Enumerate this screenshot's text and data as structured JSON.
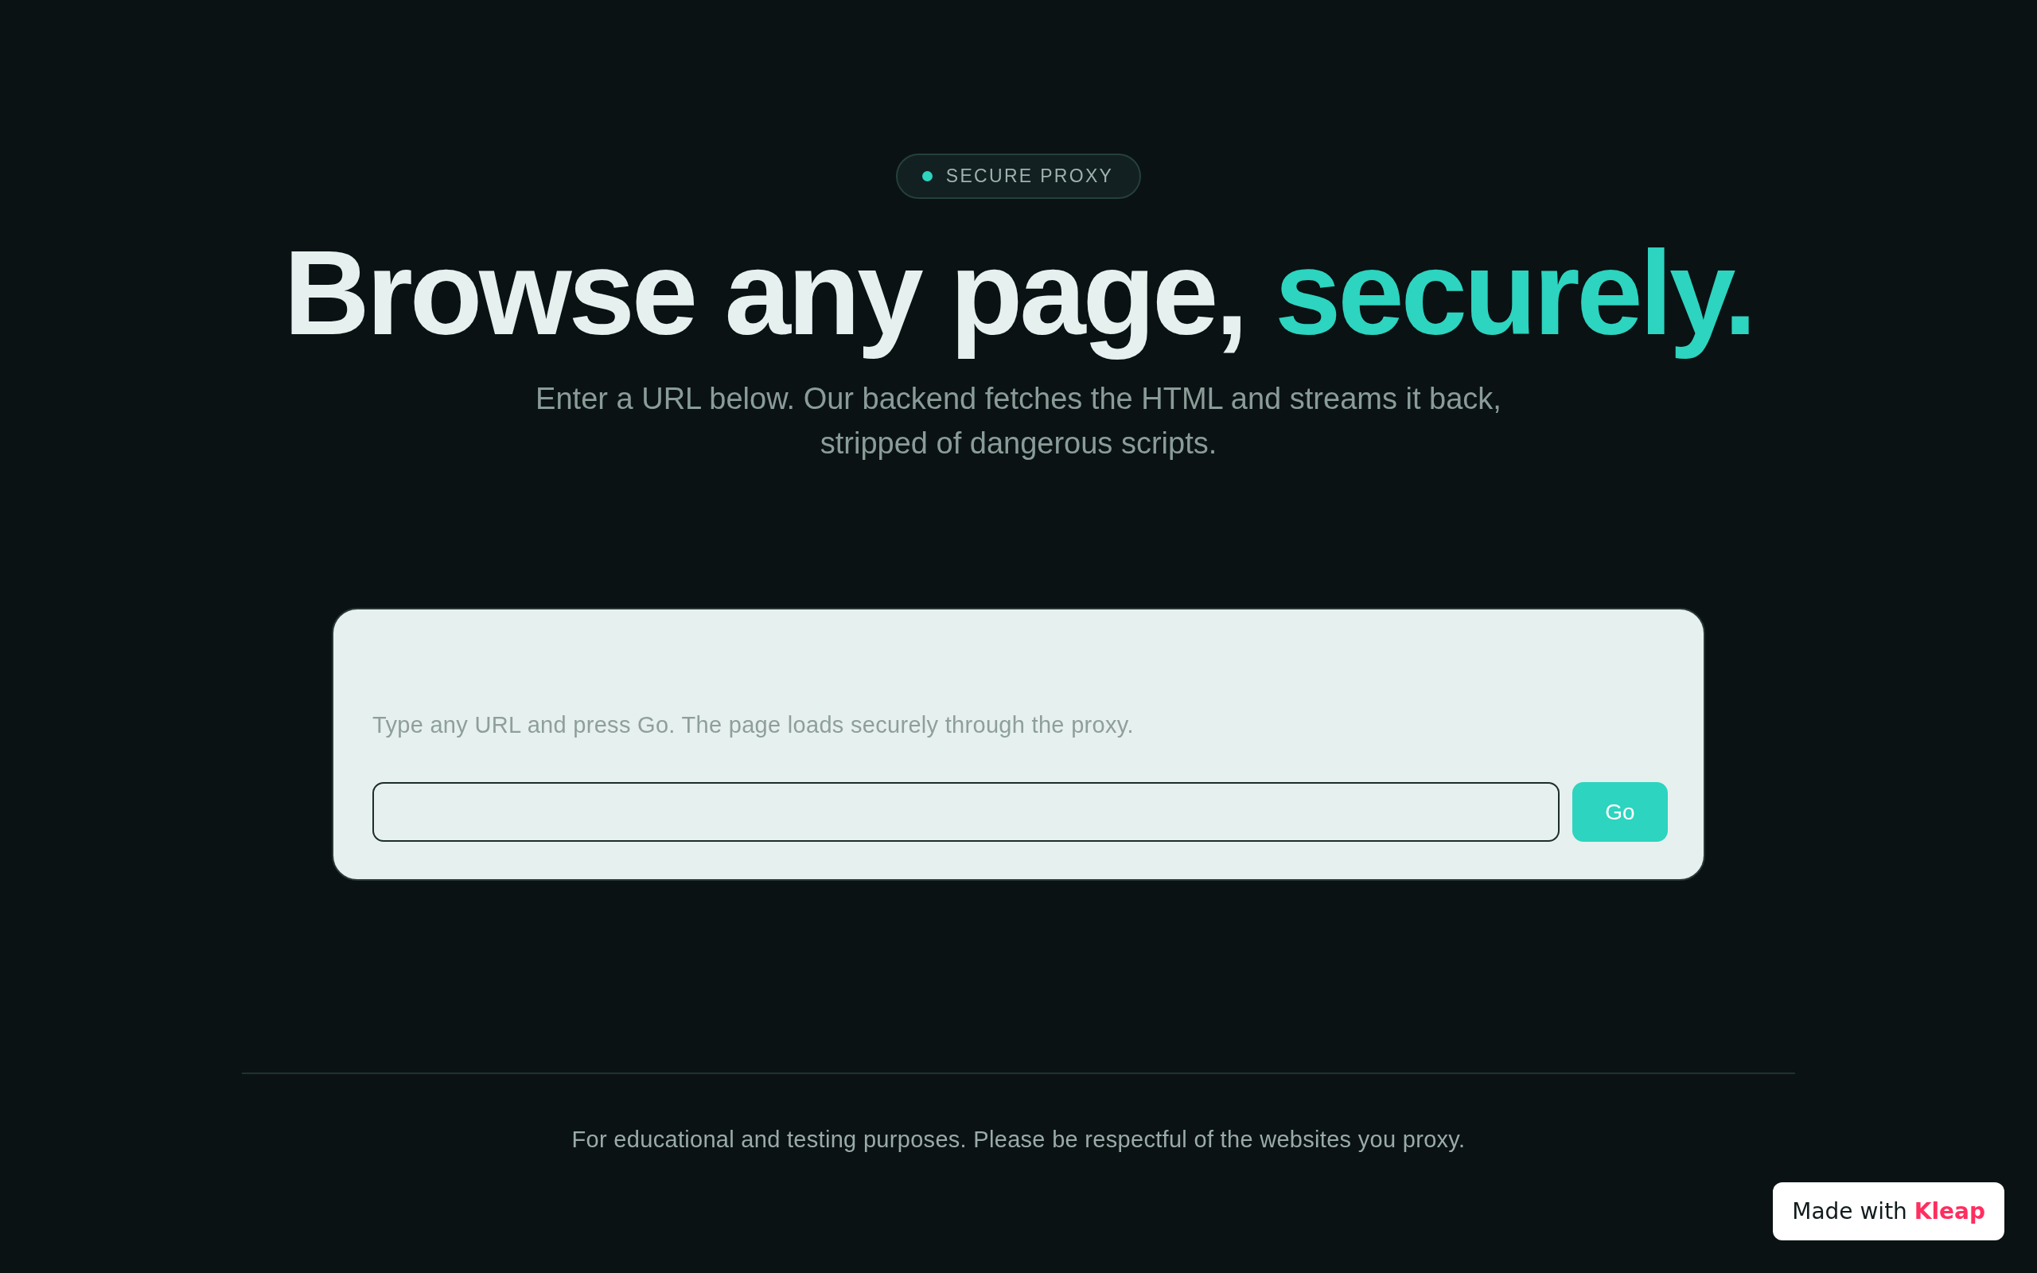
{
  "badge": {
    "label": "SECURE PROXY"
  },
  "hero": {
    "title": "Browse any page, **securely.**",
    "subtitle": "Enter a URL below. Our backend fetches the HTML and streams it back, stripped of dangerous scripts."
  },
  "proxy_form": {
    "hint": "Type any URL and press Go. The page loads securely through the proxy.",
    "button": "Go"
  },
  "footer": {
    "note": "For educational and testing purposes. Please be respectful of the websites you proxy."
  },
  "attribution": {
    "text": "Made with **Kleap**"
  }
}
